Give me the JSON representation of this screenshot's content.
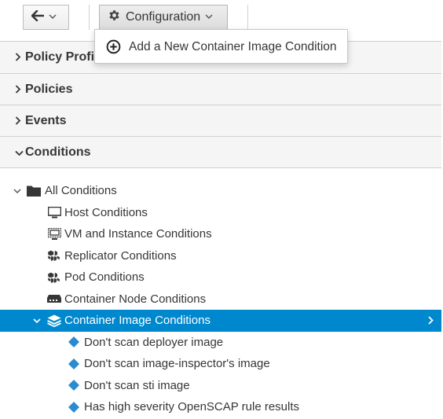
{
  "toolbar": {
    "back_icon": "arrow-left-icon",
    "configuration_label": "Configuration",
    "configuration_icon": "gear-icon"
  },
  "dropdown": {
    "items": [
      {
        "label": "Add a New Container Image Condition",
        "icon": "plus-circle-icon"
      }
    ]
  },
  "accordion": {
    "sections": [
      {
        "label": "Policy Profiles",
        "expanded": false
      },
      {
        "label": "Policies",
        "expanded": false
      },
      {
        "label": "Events",
        "expanded": false
      },
      {
        "label": "Conditions",
        "expanded": true
      }
    ]
  },
  "tree": {
    "root": {
      "label": "All Conditions",
      "icon": "folder-icon"
    },
    "children": [
      {
        "label": "Host Conditions",
        "icon": "monitor-icon"
      },
      {
        "label": "VM and Instance Conditions",
        "icon": "vm-monitor-icon"
      },
      {
        "label": "Replicator Conditions",
        "icon": "cubes-icon"
      },
      {
        "label": "Pod Conditions",
        "icon": "cubes-icon"
      },
      {
        "label": "Container Node Conditions",
        "icon": "server-icon"
      },
      {
        "label": "Container Image Conditions",
        "icon": "layers-icon",
        "selected": true
      }
    ],
    "conditions": [
      {
        "label": "Don't scan deployer image",
        "icon": "diamond-icon"
      },
      {
        "label": "Don't scan image-inspector's image",
        "icon": "diamond-icon"
      },
      {
        "label": "Don't scan sti image",
        "icon": "diamond-icon"
      },
      {
        "label": "Has high severity OpenSCAP rule results",
        "icon": "diamond-icon"
      }
    ]
  },
  "colors": {
    "selected_row": "#0088ce",
    "condition_icon": "#2a8bd0"
  }
}
